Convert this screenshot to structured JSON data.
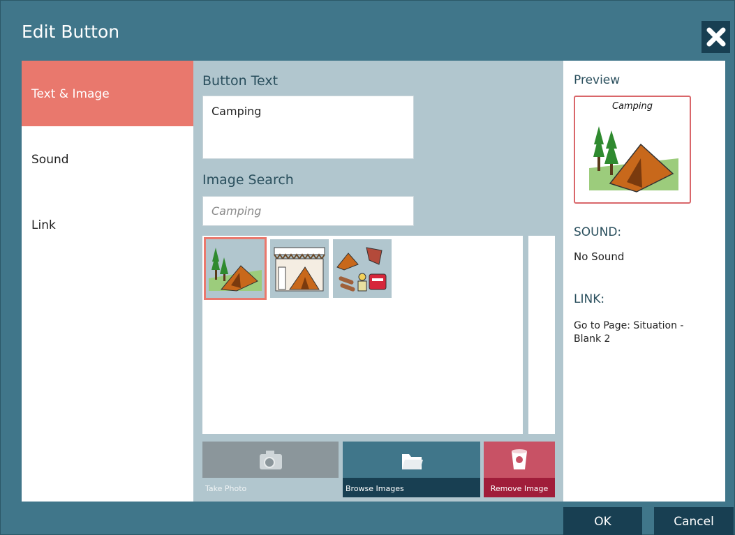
{
  "dialog": {
    "title": "Edit Button"
  },
  "sidebar": {
    "items": [
      {
        "label": "Text & Image",
        "active": true
      },
      {
        "label": "Sound",
        "active": false
      },
      {
        "label": "Link",
        "active": false
      }
    ]
  },
  "text_image": {
    "button_text_label": "Button Text",
    "button_text_value": "Camping",
    "image_search_label": "Image Search",
    "image_search_placeholder": "Camping",
    "results": [
      {
        "icon": "tent-icon",
        "selected": true
      },
      {
        "icon": "cabin-tent-icon",
        "selected": false
      },
      {
        "icon": "camping-gear-icon",
        "selected": false
      }
    ],
    "actions": {
      "take_photo": "Take Photo",
      "browse_images": "Browse Images",
      "remove_image": "Remove Image"
    }
  },
  "preview": {
    "label": "Preview",
    "button_caption": "Camping",
    "sound_label": "SOUND:",
    "sound_value": "No Sound",
    "link_label": "LINK:",
    "link_value": "Go to Page: Situation - Blank 2"
  },
  "footer": {
    "ok": "OK",
    "cancel": "Cancel"
  },
  "colors": {
    "frame": "#40768a",
    "active_tab": "#e9786d",
    "dark_button": "#183f52",
    "remove_button": "#a01d3a"
  }
}
